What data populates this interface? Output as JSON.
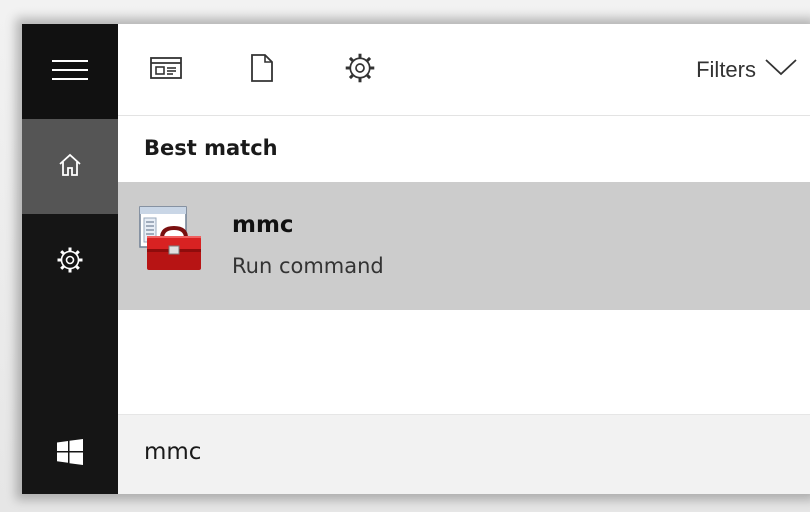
{
  "toolbar": {
    "icons": [
      "apps-icon",
      "documents-icon",
      "settings-icon"
    ],
    "filters_label": "Filters"
  },
  "rail": {
    "icons": [
      "hamburger-icon",
      "home-icon",
      "gear-icon",
      "windows-logo-icon"
    ]
  },
  "results": {
    "section_title": "Best match",
    "best_match": {
      "title": "mmc",
      "subtitle": "Run command",
      "icon": "mmc-toolbox-icon"
    }
  },
  "search": {
    "query": "mmc"
  },
  "colors": {
    "rail_bg": "#151515",
    "rail_selected": "#555555",
    "result_highlight": "#cccccc",
    "search_bg": "#f2f2f2"
  }
}
